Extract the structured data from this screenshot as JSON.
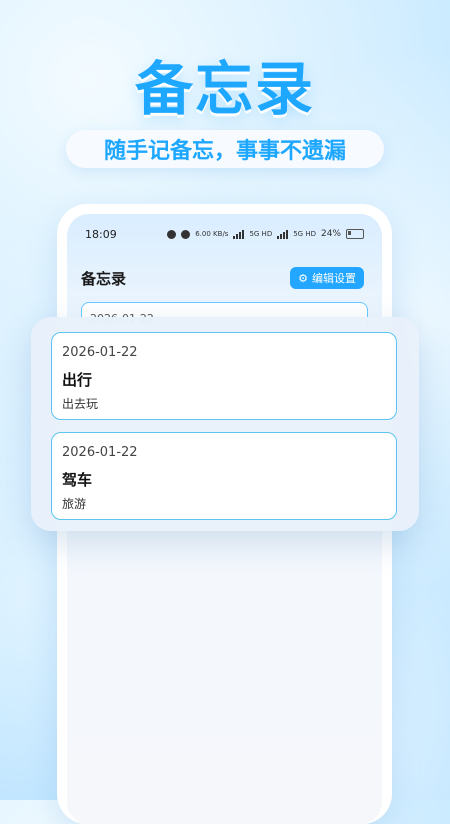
{
  "hero": {
    "title": "备忘录",
    "subtitle": "随手记备忘，事事不遗漏"
  },
  "status_bar": {
    "time": "18:09",
    "speed": "6.00 KB/s",
    "network1": "5G HD",
    "network2": "5G HD",
    "battery": "24%"
  },
  "app": {
    "title": "备忘录",
    "edit_button": "编辑设置",
    "edit_icon": "gear-icon",
    "accent_color": "#23a6ff"
  },
  "peek_note": {
    "date": "2026-01-22"
  },
  "notes": [
    {
      "date": "2026-01-22",
      "title": "出行",
      "body": "出去玩"
    },
    {
      "date": "2026-01-22",
      "title": "驾车",
      "body": "旅游"
    }
  ]
}
